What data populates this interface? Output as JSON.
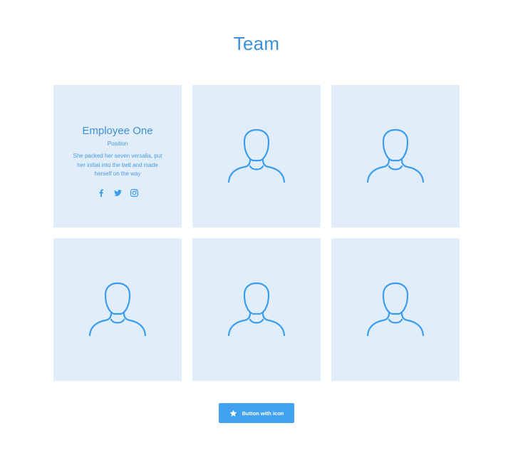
{
  "section": {
    "title": "Team"
  },
  "team": {
    "featured": {
      "name": "Employee One",
      "position": "Position",
      "bio": "She packed her seven versalia, put her initial into the belt and made herself on the way",
      "socials": [
        "facebook-icon",
        "twitter-icon",
        "instagram-icon"
      ]
    },
    "placeholder_icon": "user-outline-icon",
    "placeholder_count": 5
  },
  "cta": {
    "label": "Button with icon",
    "icon": "star-icon"
  },
  "colors": {
    "accent": "#3d8fd6",
    "card_bg": "#e1eefa",
    "button_bg": "#42a2f1",
    "icon_stroke": "#3b9ded"
  }
}
